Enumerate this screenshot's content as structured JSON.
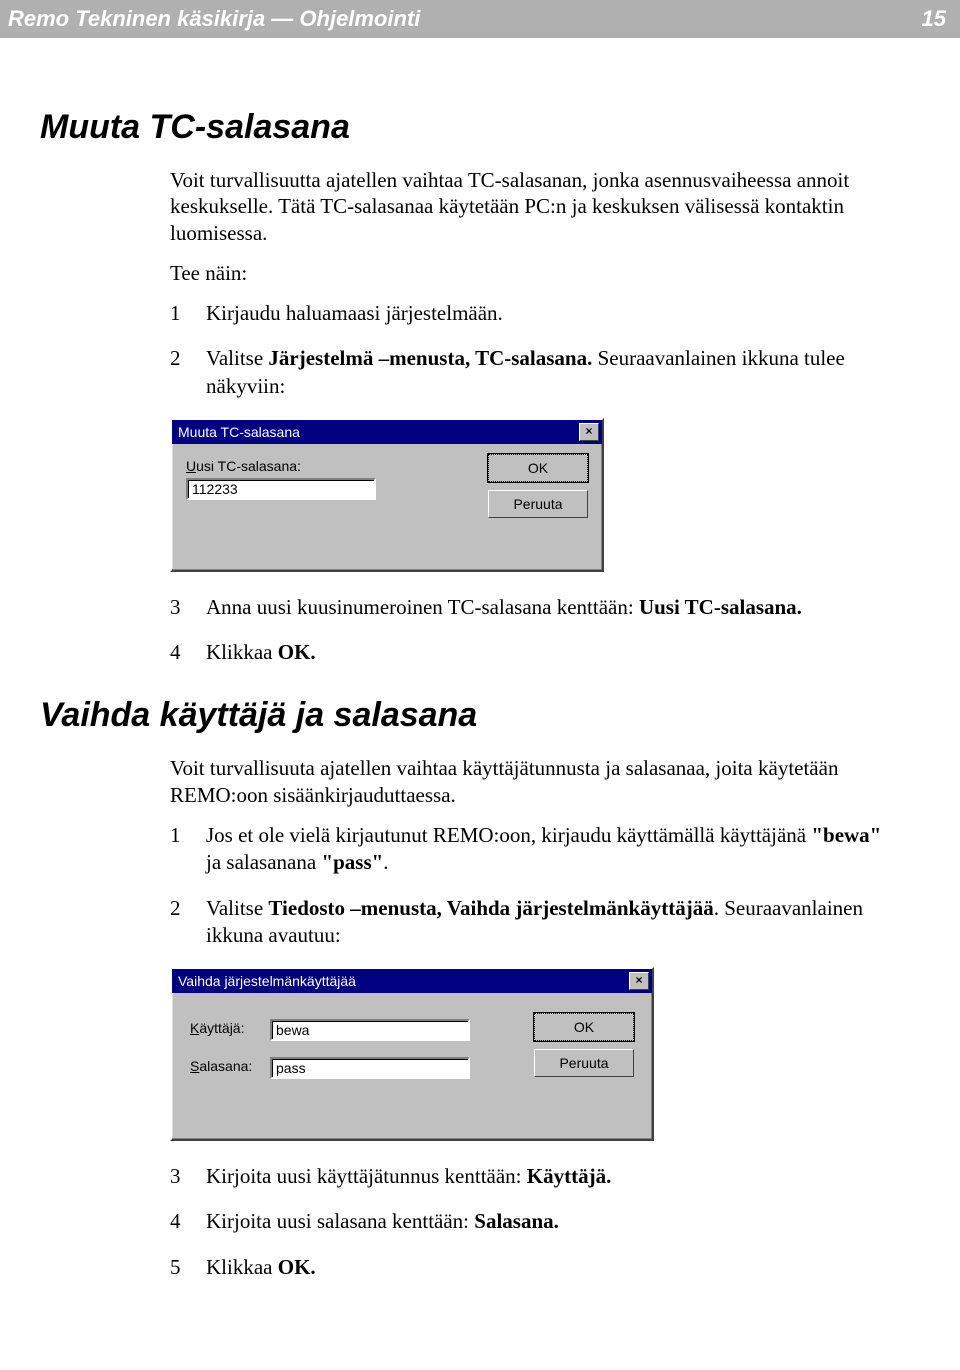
{
  "header": {
    "title": "Remo Tekninen käsikirja — Ohjelmointi",
    "page_number": "15"
  },
  "section1": {
    "title": "Muuta TC-salasana",
    "intro": "Voit turvallisuutta ajatellen vaihtaa TC-salasanan, jonka asennusvaiheessa annoit keskukselle. Tätä TC-salasanaa käytetään PC:n ja keskuksen välisessä kontaktin luomisessa.",
    "lead": "Tee näin:",
    "steps": {
      "s1": "Kirjaudu haluamaasi järjestelmään.",
      "s2_pre": "Valitse ",
      "s2_bold": "Järjestelmä –menusta, TC-salasana.",
      "s2_post": " Seuraavanlainen ikkuna tulee näkyviin:",
      "s3_pre": "Anna uusi kuusinumeroinen TC-salasana kenttään: ",
      "s3_bold": "Uusi TC-salasana.",
      "s4_pre": "Klikkaa ",
      "s4_bold": "OK."
    }
  },
  "dialog1": {
    "title": "Muuta TC-salasana",
    "field_label": "Uusi TC-salasana:",
    "field_value": "112233",
    "ok": "OK",
    "cancel": "Peruuta",
    "close_glyph": "×"
  },
  "section2": {
    "title": "Vaihda käyttäjä ja salasana",
    "intro": "Voit turvallisuuta ajatellen vaihtaa käyttäjätunnusta ja salasanaa, joita käytetään REMO:oon sisäänkirjauduttaessa.",
    "steps": {
      "s1_pre": "Jos et ole vielä kirjautunut REMO:oon, kirjaudu käyttämällä käyttäjänä ",
      "s1_q1": "\"bewa\"",
      "s1_mid": " ja salasanana ",
      "s1_q2": "\"pass\"",
      "s1_end": ".",
      "s2_pre": "Valitse ",
      "s2_bold": "Tiedosto –menusta, Vaihda järjestelmänkäyttäjää",
      "s2_post": ". Seuraavanlainen ikkuna avautuu:",
      "s3_pre": "Kirjoita uusi käyttäjätunnus kenttään: ",
      "s3_bold": "Käyttäjä.",
      "s4_pre": "Kirjoita uusi salasana kenttään: ",
      "s4_bold": "Salasana.",
      "s5_pre": "Klikkaa ",
      "s5_bold": "OK."
    }
  },
  "dialog2": {
    "title": "Vaihda järjestelmänkäyttäjää",
    "user_label": "Käyttäjä:",
    "user_value": "bewa",
    "pass_label": "Salasana:",
    "pass_value": "pass",
    "ok": "OK",
    "cancel": "Peruuta",
    "close_glyph": "×"
  },
  "nums": {
    "n1": "1",
    "n2": "2",
    "n3": "3",
    "n4": "4",
    "n5": "5"
  }
}
